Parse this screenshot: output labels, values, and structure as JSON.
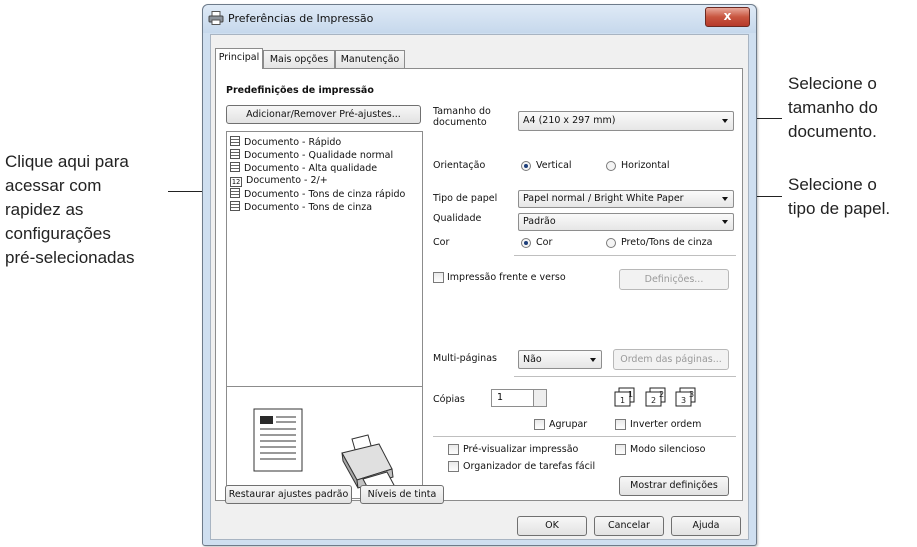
{
  "callouts": {
    "left": [
      "Clique aqui para",
      "acessar com",
      "rapidez as",
      "configurações",
      "pré-selecionadas"
    ],
    "right_top": [
      "Selecione o",
      "tamanho do",
      "documento."
    ],
    "right_mid": [
      "Selecione o",
      "tipo de papel."
    ]
  },
  "window": {
    "title": "Preferências de Impressão",
    "close_label": "x"
  },
  "tabs": [
    "Principal",
    "Mais opções",
    "Manutenção"
  ],
  "presets": {
    "heading": "Predefinições de impressão",
    "add_remove_label": "Adicionar/Remover Pré-ajustes...",
    "items": [
      {
        "label": "Documento - Rápido",
        "icon": "document-icon"
      },
      {
        "label": "Documento - Qualidade normal",
        "icon": "document-icon"
      },
      {
        "label": "Documento - Alta qualidade",
        "icon": "document-icon"
      },
      {
        "label": "Documento - 2/+",
        "icon": "two-pages-icon",
        "badge": "12"
      },
      {
        "label": "Documento - Tons de cinza rápido",
        "icon": "document-icon"
      },
      {
        "label": "Documento - Tons de cinza",
        "icon": "document-icon"
      }
    ]
  },
  "settings": {
    "doc_size_label": "Tamanho do documento",
    "doc_size_value": "A4 (210 x 297 mm)",
    "orientation_label": "Orientação",
    "orientation_options": [
      "Vertical",
      "Horizontal"
    ],
    "orientation_selected": "Vertical",
    "paper_type_label": "Tipo de papel",
    "paper_type_value": "Papel normal / Bright White Paper",
    "quality_label": "Qualidade",
    "quality_value": "Padrão",
    "color_label": "Cor",
    "color_options": [
      "Cor",
      "Preto/Tons de cinza"
    ],
    "color_selected": "Cor",
    "duplex_label": "Impressão frente e verso",
    "duplex_checked": false,
    "duplex_settings_label": "Definições...",
    "multipage_label": "Multi-páginas",
    "multipage_value": "Não",
    "page_order_label": "Ordem das páginas...",
    "copies_label": "Cópias",
    "copies_value": "1",
    "collate_label": "Agrupar",
    "reverse_label": "Inverter ordem",
    "preview_label": "Pré-visualizar impressão",
    "quiet_label": "Modo silencioso",
    "organizer_label": "Organizador de tarefas fácil",
    "show_settings_label": "Mostrar definições"
  },
  "bottom": {
    "restore_label": "Restaurar ajustes padrão",
    "ink_label": "Níveis de tinta"
  },
  "footer": {
    "ok_label": "OK",
    "cancel_label": "Cancelar",
    "help_label": "Ajuda"
  }
}
